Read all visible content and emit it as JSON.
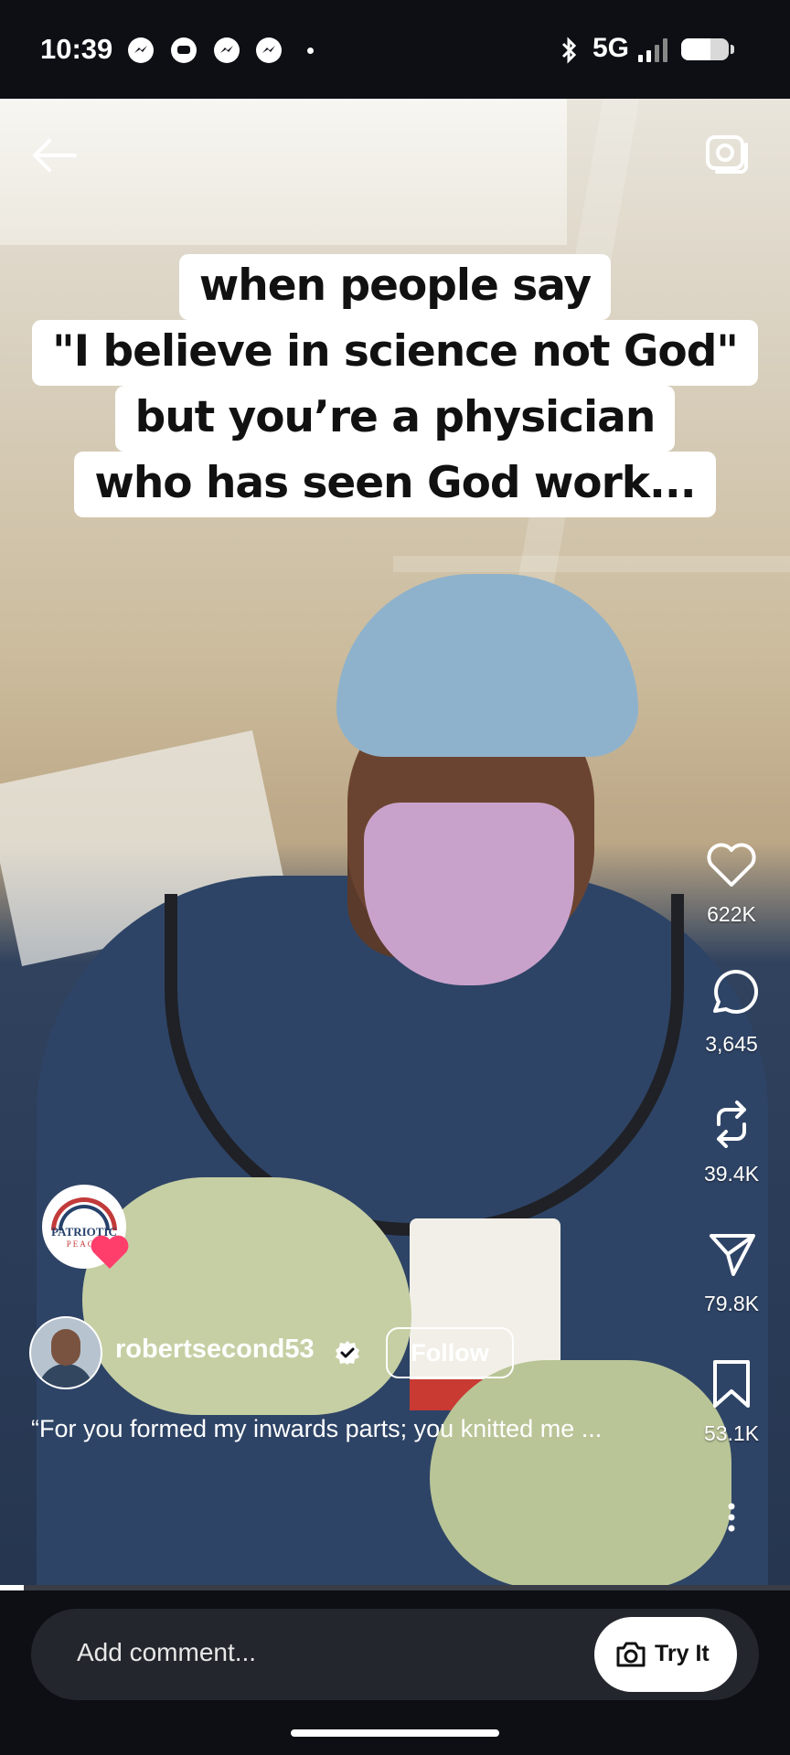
{
  "status_bar": {
    "time": "10:39",
    "network": "5G",
    "battery_level": 0.62
  },
  "video": {
    "overlay_lines": [
      "when people say",
      "\"I believe in science not God\"",
      "but you’re a physician",
      "who has seen God work..."
    ],
    "progress": 0.03
  },
  "actions": {
    "likes": "622K",
    "comments": "3,645",
    "reposts": "39.4K",
    "shares": "79.8K",
    "saves": "53.1K"
  },
  "promo_badge": {
    "title": "PATRIOTIC",
    "subtitle": "PEACE"
  },
  "author": {
    "username": "robertsecond53",
    "follow_label": "Follow"
  },
  "caption_text": "“For you formed my inwards parts; you knitted me ...",
  "comment_bar": {
    "placeholder": "Add comment...",
    "try_label": "Try It"
  },
  "colors": {
    "background": "#0d0f14",
    "comment_bar": "#24262d",
    "accent_heart": "#ff3e6c"
  },
  "icons": [
    "back-arrow-icon",
    "camera-icon",
    "heart-icon",
    "comment-icon",
    "repost-icon",
    "share-icon",
    "bookmark-icon",
    "more-icon",
    "verified-icon",
    "camera-icon"
  ]
}
